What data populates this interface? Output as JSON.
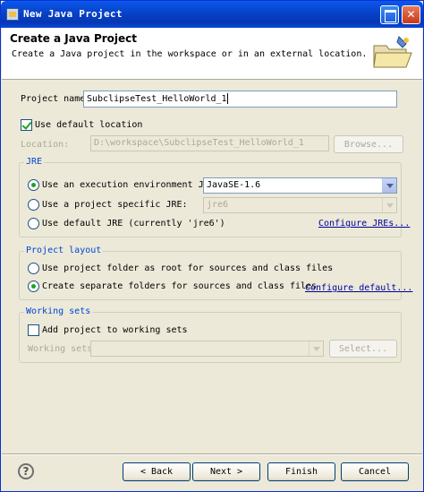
{
  "window": {
    "title": "New Java Project"
  },
  "header": {
    "title": "Create a Java Project",
    "description": "Create a Java project in the workspace or in an external location."
  },
  "project": {
    "name_label": "Project name:",
    "name_value": "SubclipseTest_HelloWorld_1"
  },
  "location": {
    "use_default_label": "Use default location",
    "use_default_checked": true,
    "location_label": "Location:",
    "location_value": "D:\\workspace\\SubclipseTest_HelloWorld_1",
    "browse_label": "Browse..."
  },
  "jre": {
    "group_title": "JRE",
    "option_env_label": "Use an execution environment JRE:",
    "option_env_value": "JavaSE-1.6",
    "option_specific_label": "Use a project specific JRE:",
    "option_specific_value": "jre6",
    "option_default_label": "Use default JRE (currently 'jre6')",
    "configure_link": "Configure JREs...",
    "selected": "execution-environment"
  },
  "layout": {
    "group_title": "Project layout",
    "option_root_label": "Use project folder as root for sources and class files",
    "option_separate_label": "Create separate folders for sources and class files",
    "configure_link": "Configure default...",
    "selected": "separate"
  },
  "working_sets": {
    "group_title": "Working sets",
    "add_label": "Add project to working sets",
    "add_checked": false,
    "sets_label": "Working sets:",
    "select_label": "Select..."
  },
  "footer": {
    "help_icon": "?",
    "back_label": "< Back",
    "next_label": "Next >",
    "finish_label": "Finish",
    "cancel_label": "Cancel"
  }
}
